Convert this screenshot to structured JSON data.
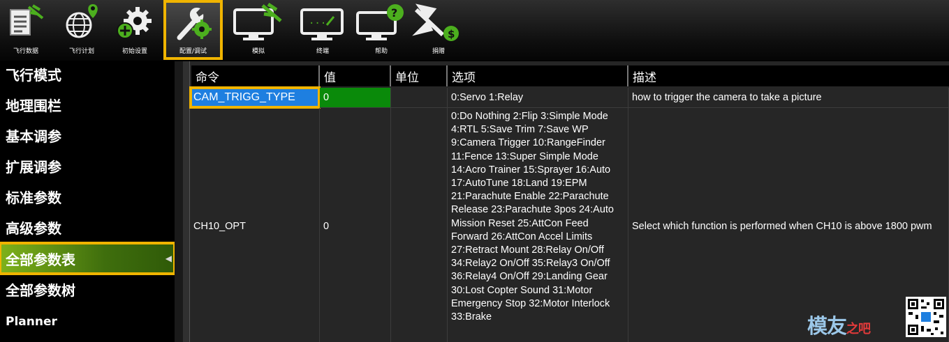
{
  "toolbar": {
    "items": [
      {
        "label": "飞行数据",
        "icon": "flight-data-icon"
      },
      {
        "label": "飞行计划",
        "icon": "flight-plan-globe-icon"
      },
      {
        "label": "初始设置",
        "icon": "initial-setup-gear-icon"
      },
      {
        "label": "配置/调试",
        "icon": "config-tuning-wrench-icon"
      },
      {
        "label": "模拟",
        "icon": "simulation-monitor-icon"
      },
      {
        "label": "终端",
        "icon": "terminal-monitor-icon"
      },
      {
        "label": "帮助",
        "icon": "help-monitor-icon"
      },
      {
        "label": "捐赠",
        "icon": "donate-plane-icon"
      }
    ],
    "active_index": 3,
    "accent_color": "#f0b400"
  },
  "sidebar": {
    "items": [
      {
        "label": "飞行模式"
      },
      {
        "label": "地理围栏"
      },
      {
        "label": "基本调参"
      },
      {
        "label": "扩展调参"
      },
      {
        "label": "标准参数"
      },
      {
        "label": "高级参数"
      },
      {
        "label": "全部参数表"
      },
      {
        "label": "全部参数树"
      },
      {
        "label": "Planner"
      }
    ],
    "active_index": 6,
    "active_color": "#5a9214"
  },
  "grid": {
    "columns": [
      "命令",
      "值",
      "单位",
      "选项",
      "描述"
    ],
    "rows": [
      {
        "command": "CAM_TRIGG_TYPE",
        "value": "0",
        "unit": "",
        "options": "0:Servo 1:Relay",
        "description": "how to trigger the camera to take a picture"
      },
      {
        "command": "CH10_OPT",
        "value": "0",
        "unit": "",
        "options": "0:Do Nothing 2:Flip 3:Simple Mode 4:RTL 5:Save Trim 7:Save WP 9:Camera Trigger 10:RangeFinder 11:Fence 13:Super Simple Mode 14:Acro Trainer 15:Sprayer 16:Auto 17:AutoTune 18:Land 19:EPM 21:Parachute Enable 22:Parachute Release 23:Parachute 3pos 24:Auto Mission Reset 25:AttCon Feed Forward 26:AttCon Accel Limits 27:Retract Mount 28:Relay On/Off 34:Relay2 On/Off 35:Relay3 On/Off 36:Relay4 On/Off 29:Landing Gear 30:Lost Copter Sound 31:Motor Emergency Stop 32:Motor Interlock 33:Brake",
        "description": "Select which function is performed when CH10 is above 1800 pwm"
      }
    ],
    "selected_name_color": "#1e7fe0",
    "selected_value_color": "#0a8a0a"
  },
  "watermark": {
    "text_main": "模友",
    "text_small": "之吧",
    "icon": "qr-code-icon"
  }
}
